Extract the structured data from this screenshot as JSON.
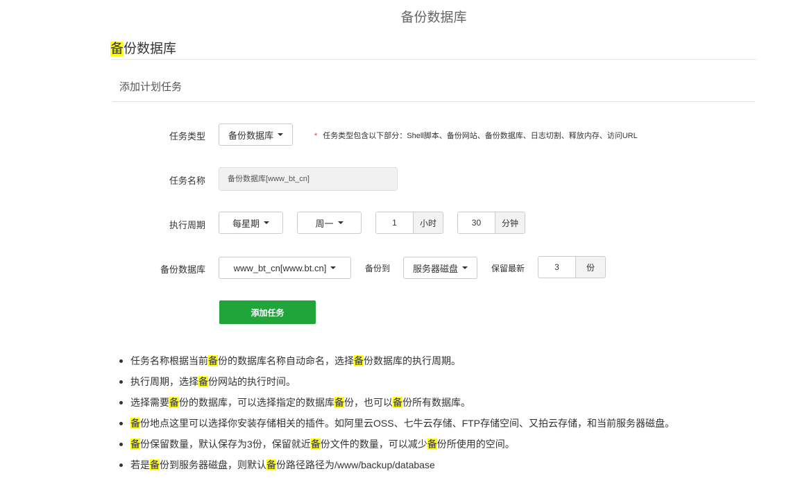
{
  "page": {
    "title": "备份数据库"
  },
  "section": {
    "title_highlight": "备",
    "title_rest": "份数据库",
    "subtitle": "添加计划任务"
  },
  "form": {
    "task_type": {
      "label": "任务类型",
      "value": "备份数据库",
      "hint_star": "*",
      "hint": "任务类型包含以下部分：Shell脚本、备份网站、备份数据库、日志切割、释放内存、访问URL"
    },
    "task_name": {
      "label": "任务名称",
      "value": "备份数据库[www_bt_cn]"
    },
    "cycle": {
      "label": "执行周期",
      "period": "每星期",
      "weekday": "周一",
      "hour": "1",
      "hour_unit": "小时",
      "minute": "30",
      "minute_unit": "分钟"
    },
    "backup": {
      "label": "备份数据库",
      "database": "www_bt_cn[www.bt.cn]",
      "backup_to_label": "备份到",
      "backup_to": "服务器磁盘",
      "keep_label": "保留最新",
      "keep_value": "3",
      "keep_unit": "份"
    },
    "submit_label": "添加任务"
  },
  "notes": [
    [
      {
        "t": "任务名称根据当前"
      },
      {
        "t": "备",
        "h": true
      },
      {
        "t": "份的数据库名称自动命名，选择"
      },
      {
        "t": "备",
        "h": true
      },
      {
        "t": "份数据库的执行周期。"
      }
    ],
    [
      {
        "t": "执行周期，选择"
      },
      {
        "t": "备",
        "h": true
      },
      {
        "t": "份网站的执行时间。"
      }
    ],
    [
      {
        "t": "选择需要"
      },
      {
        "t": "备",
        "h": true
      },
      {
        "t": "份的数据库，可以选择指定的数据库"
      },
      {
        "t": "备",
        "h": true
      },
      {
        "t": "份，也可以"
      },
      {
        "t": "备",
        "h": true
      },
      {
        "t": "份所有数据库。"
      }
    ],
    [
      {
        "t": "备",
        "h": true
      },
      {
        "t": "份地点这里可以选择你安装存储相关的插件。如阿里云OSS、七牛云存储、FTP存储空间、又拍云存储，和当前服务器磁盘。"
      }
    ],
    [
      {
        "t": "备",
        "h": true
      },
      {
        "t": "份保留数量，默认保存为3份，保留就近"
      },
      {
        "t": "备",
        "h": true
      },
      {
        "t": "份文件的数量，可以减少"
      },
      {
        "t": "备",
        "h": true
      },
      {
        "t": "份所使用的空间。"
      }
    ],
    [
      {
        "t": "若是"
      },
      {
        "t": "备",
        "h": true
      },
      {
        "t": "份到服务器磁盘，则默认"
      },
      {
        "t": "备",
        "h": true
      },
      {
        "t": "份路径路径为/www/backup/database"
      }
    ]
  ]
}
